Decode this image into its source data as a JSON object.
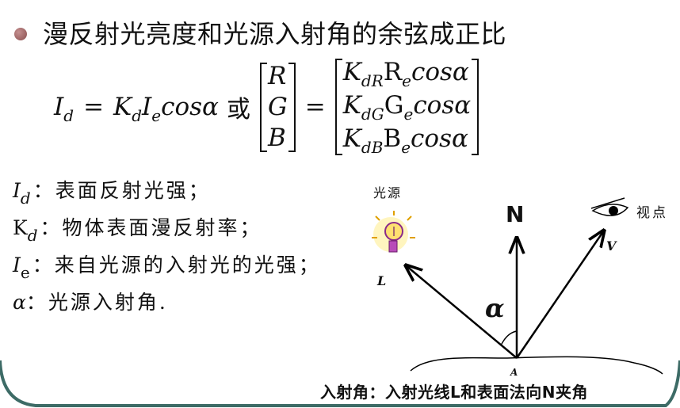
{
  "title": "漫反射光亮度和光源入射角的余弦成正比",
  "formula": {
    "lhs_I": "I",
    "lhs_I_sub": "d",
    "equals": "=",
    "K": "K",
    "K_sub": "d",
    "I": "I",
    "I_sub": "e",
    "cos": "cosα",
    "or": "或",
    "vector": [
      "R",
      "G",
      "B"
    ],
    "matrix_rows": [
      {
        "K": "K",
        "sub": "dR",
        "c": "R",
        "c_sub": "e",
        "cos": "cosα"
      },
      {
        "K": "K",
        "sub": "dG",
        "c": "G",
        "c_sub": "e",
        "cos": "cosα"
      },
      {
        "K": "K",
        "sub": "dB",
        "c": "B",
        "c_sub": "e",
        "cos": "cosα"
      }
    ]
  },
  "definitions": [
    {
      "sym": "I",
      "sub": "d",
      "text": "：表面反射光强；"
    },
    {
      "sym": "K",
      "sub": "d",
      "text": "：物体表面漫反射率；"
    },
    {
      "sym": "I",
      "sub": "e",
      "text": "：来自光源的入射光的光强；"
    },
    {
      "sym": "α",
      "sub": "",
      "text": "：光源入射角."
    }
  ],
  "diagram": {
    "light_source_label": "光源",
    "viewpoint_label": "视点",
    "normal_label": "N",
    "L_label": "L",
    "V_label": "V",
    "A_label": "A",
    "angle_label": "α",
    "caption": "入射角：入射光线L和表面法向N夹角"
  },
  "colors": {
    "bullet": "#a06060",
    "arc": "#3d6b66"
  }
}
